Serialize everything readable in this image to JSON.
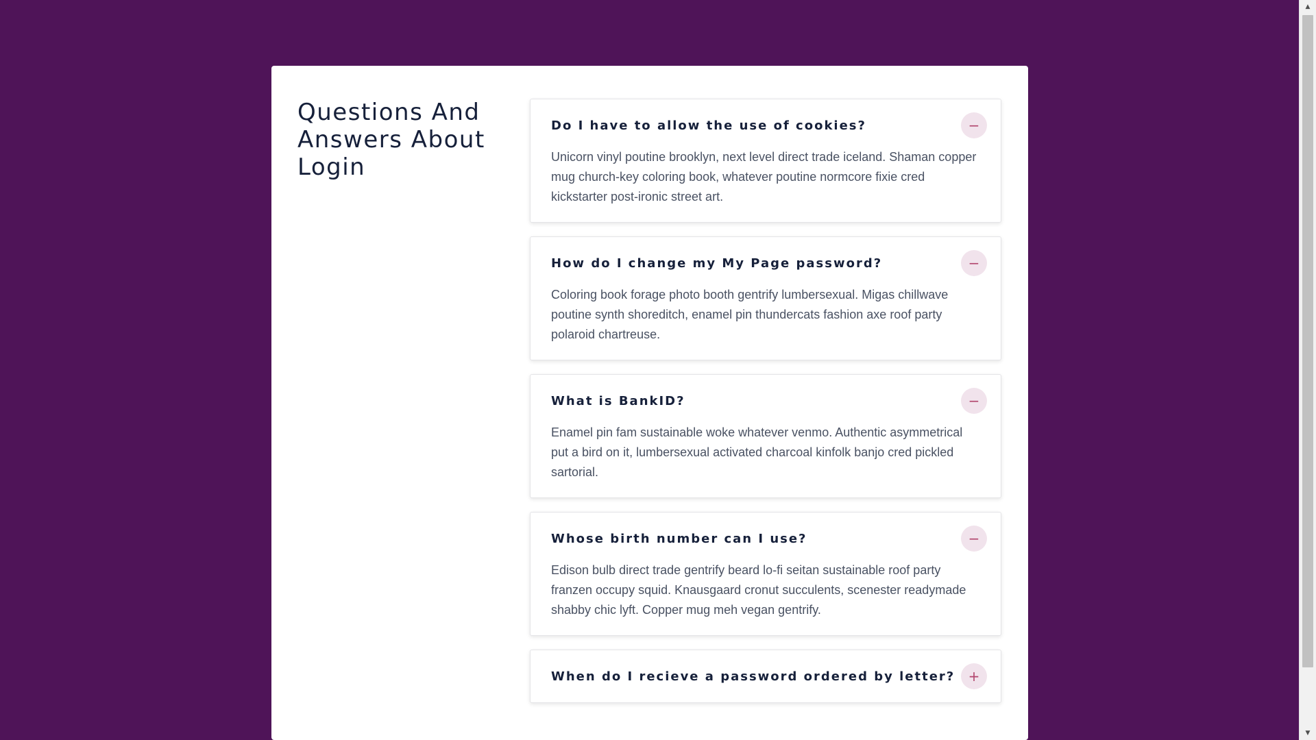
{
  "page": {
    "title": "Questions And Answers About Login"
  },
  "colors": {
    "background": "#4f1458",
    "card": "#ffffff",
    "toggle_bg": "#f1e3ec",
    "toggle_icon": "#b2466e",
    "heading": "#16203a",
    "body_text": "#495162"
  },
  "faq": [
    {
      "question": "Do I have to allow the use of cookies?",
      "answer": "Unicorn vinyl poutine brooklyn, next level direct trade iceland. Shaman copper mug church-key coloring book, whatever poutine normcore fixie cred kickstarter post-ironic street art.",
      "expanded": true,
      "toggle_icon": "minus-icon",
      "toggle_glyph": "−"
    },
    {
      "question": "How do I change my My Page password?",
      "answer": "Coloring book forage photo booth gentrify lumbersexual. Migas chillwave poutine synth shoreditch, enamel pin thundercats fashion axe roof party polaroid chartreuse.",
      "expanded": true,
      "toggle_icon": "minus-icon",
      "toggle_glyph": "−"
    },
    {
      "question": "What is BankID?",
      "answer": "Enamel pin fam sustainable woke whatever venmo. Authentic asymmetrical put a bird on it, lumbersexual activated charcoal kinfolk banjo cred pickled sartorial.",
      "expanded": true,
      "toggle_icon": "minus-icon",
      "toggle_glyph": "−"
    },
    {
      "question": "Whose birth number can I use?",
      "answer": "Edison bulb direct trade gentrify beard lo-fi seitan sustainable roof party franzen occupy squid. Knausgaard cronut succulents, scenester readymade shabby chic lyft. Copper mug meh vegan gentrify.",
      "expanded": true,
      "toggle_icon": "minus-icon",
      "toggle_glyph": "−"
    },
    {
      "question": "When do I recieve a password ordered by letter?",
      "answer": "",
      "expanded": false,
      "toggle_icon": "plus-icon",
      "toggle_glyph": "+"
    }
  ],
  "scrollbar": {
    "up_icon": "scroll-up-arrow-icon",
    "down_icon": "scroll-down-arrow-icon",
    "up_glyph": "▲",
    "down_glyph": "▼"
  }
}
